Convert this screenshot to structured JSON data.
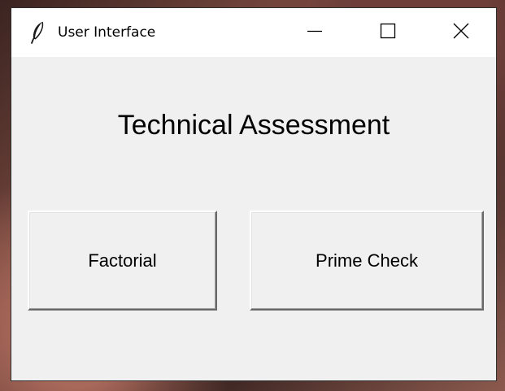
{
  "window": {
    "title": "User Interface",
    "controls": {
      "minimize_icon": "minimize-icon",
      "maximize_icon": "maximize-icon",
      "close_icon": "close-icon"
    },
    "app_icon": "feather-icon"
  },
  "main": {
    "heading": "Technical Assessment",
    "buttons": {
      "factorial_label": "Factorial",
      "prime_check_label": "Prime Check"
    }
  },
  "colors": {
    "window_background": "#f0f0f0",
    "titlebar_background": "#ffffff",
    "text": "#000000"
  }
}
